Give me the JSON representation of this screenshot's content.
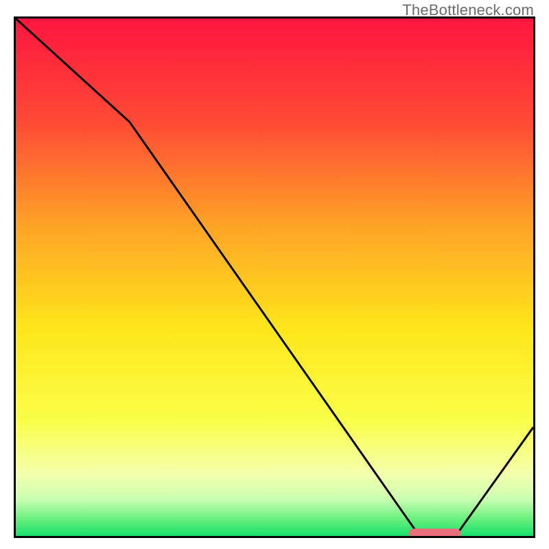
{
  "watermark": "TheBottleneck.com",
  "chart_data": {
    "type": "line",
    "title": "",
    "xlabel": "",
    "ylabel": "",
    "xlim": [
      0,
      100
    ],
    "ylim": [
      0,
      100
    ],
    "x": [
      0,
      22,
      78,
      85,
      100
    ],
    "values": [
      100,
      80,
      0,
      0,
      21
    ],
    "marker": {
      "x_start": 76,
      "x_end": 86,
      "y": 0.5
    },
    "gradient_stops": [
      {
        "pos": 0.0,
        "color": "#ff163f"
      },
      {
        "pos": 0.2,
        "color": "#ff4a35"
      },
      {
        "pos": 0.4,
        "color": "#ffa326"
      },
      {
        "pos": 0.6,
        "color": "#ffe61b"
      },
      {
        "pos": 0.78,
        "color": "#faff4a"
      },
      {
        "pos": 0.88,
        "color": "#f4ffad"
      },
      {
        "pos": 0.93,
        "color": "#c9ffb0"
      },
      {
        "pos": 0.965,
        "color": "#6ef07f"
      },
      {
        "pos": 1.0,
        "color": "#18e06a"
      }
    ],
    "marker_color": "#e9707a",
    "curve_color": "#000000"
  }
}
